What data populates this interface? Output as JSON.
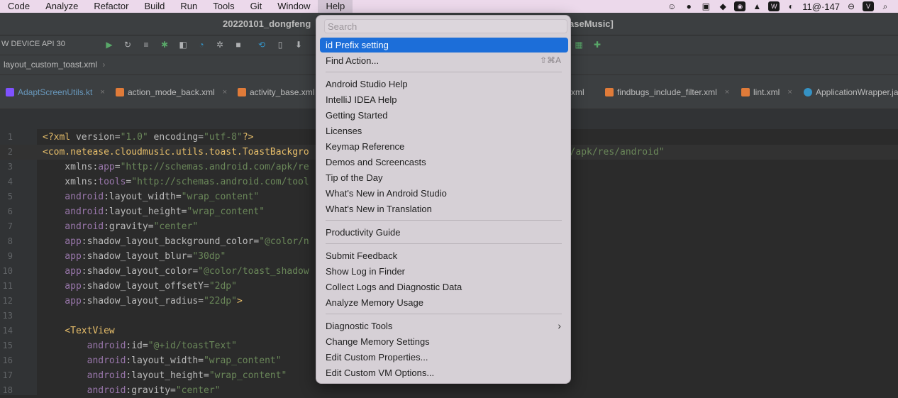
{
  "menubar": {
    "items": [
      "Code",
      "Analyze",
      "Refactor",
      "Build",
      "Run",
      "Tools",
      "Git",
      "Window",
      "Help"
    ],
    "status_text": "11@·147"
  },
  "titlebar": {
    "project": "20220101_dongfeng",
    "module_suffix": "aseMusic]"
  },
  "toolbar": {
    "device": "W DEVICE API 30"
  },
  "breadcrumb": {
    "file": "layout_custom_toast.xml",
    "chevron": "›"
  },
  "tabs": [
    {
      "label": "AdaptScreenUtils.kt",
      "icon_color": "#7f52ff"
    },
    {
      "label": "action_mode_back.xml",
      "icon_color": "#e07b39"
    },
    {
      "label": "activity_base.xml",
      "icon_color": "#e07b39"
    },
    {
      "label": "xml",
      "icon_color": ""
    },
    {
      "label": "findbugs_include_filter.xml",
      "icon_color": "#e07b39"
    },
    {
      "label": "lint.xml",
      "icon_color": "#e07b39"
    },
    {
      "label": "ApplicationWrapper.ja",
      "icon_color": "#3592c4"
    }
  ],
  "editor": {
    "line_numbers": [
      "1",
      "2",
      "3",
      "4",
      "5",
      "6",
      "7",
      "8",
      "9",
      "10",
      "11",
      "12",
      "13",
      "14",
      "15",
      "16",
      "17",
      "18"
    ],
    "lines": [
      [
        [
          "t-pun",
          "<?xml "
        ],
        [
          "t-attr",
          "version="
        ],
        [
          "t-val",
          "\"1.0\""
        ],
        [
          "t-attr",
          " encoding="
        ],
        [
          "t-val",
          "\"utf-8\""
        ],
        [
          "t-pun",
          "?>"
        ]
      ],
      [
        [
          "t-tag",
          "<com.netease.cloudmusic.utils.toast.ToastBackgro"
        ],
        [
          "t-attr",
          "                                         "
        ],
        [
          "t-val",
          "id.com/apk/res/android\""
        ]
      ],
      [
        [
          "t-attr",
          "    xmlns:"
        ],
        [
          "t-ns",
          "app"
        ],
        [
          "t-attr",
          "="
        ],
        [
          "t-val",
          "\"http://schemas.android.com/apk/re"
        ]
      ],
      [
        [
          "t-attr",
          "    xmlns:"
        ],
        [
          "t-ns",
          "tools"
        ],
        [
          "t-attr",
          "="
        ],
        [
          "t-val",
          "\"http://schemas.android.com/tool"
        ]
      ],
      [
        [
          "t-ns",
          "    android"
        ],
        [
          "t-attr",
          ":layout_width="
        ],
        [
          "t-val",
          "\"wrap_content\""
        ]
      ],
      [
        [
          "t-ns",
          "    android"
        ],
        [
          "t-attr",
          ":layout_height="
        ],
        [
          "t-val",
          "\"wrap_content\""
        ]
      ],
      [
        [
          "t-ns",
          "    android"
        ],
        [
          "t-attr",
          ":gravity="
        ],
        [
          "t-val",
          "\"center\""
        ]
      ],
      [
        [
          "t-ns",
          "    app"
        ],
        [
          "t-attr",
          ":shadow_layout_background_color="
        ],
        [
          "t-val",
          "\"@color/n"
        ]
      ],
      [
        [
          "t-ns",
          "    app"
        ],
        [
          "t-attr",
          ":shadow_layout_blur="
        ],
        [
          "t-val",
          "\"30dp\""
        ]
      ],
      [
        [
          "t-ns",
          "    app"
        ],
        [
          "t-attr",
          ":shadow_layout_color="
        ],
        [
          "t-val",
          "\"@color/toast_shadow"
        ]
      ],
      [
        [
          "t-ns",
          "    app"
        ],
        [
          "t-attr",
          ":shadow_layout_offsetY="
        ],
        [
          "t-val",
          "\"2dp\""
        ]
      ],
      [
        [
          "t-ns",
          "    app"
        ],
        [
          "t-attr",
          ":shadow_layout_radius="
        ],
        [
          "t-val",
          "\"22dp\""
        ],
        [
          "t-pun",
          ">"
        ]
      ],
      [
        [
          "t-attr",
          ""
        ]
      ],
      [
        [
          "t-tag",
          "    <TextView"
        ]
      ],
      [
        [
          "t-ns",
          "        android"
        ],
        [
          "t-attr",
          ":id="
        ],
        [
          "t-val",
          "\"@+id/toastText\""
        ]
      ],
      [
        [
          "t-ns",
          "        android"
        ],
        [
          "t-attr",
          ":layout_width="
        ],
        [
          "t-val",
          "\"wrap_content\""
        ]
      ],
      [
        [
          "t-ns",
          "        android"
        ],
        [
          "t-attr",
          ":layout_height="
        ],
        [
          "t-val",
          "\"wrap_content\""
        ]
      ],
      [
        [
          "t-ns",
          "        android"
        ],
        [
          "t-attr",
          ":gravity="
        ],
        [
          "t-val",
          "\"center\""
        ]
      ]
    ]
  },
  "help_menu": {
    "search_placeholder": "Search",
    "items": {
      "id_prefix": "id Prefix setting",
      "find_action": "Find Action...",
      "find_action_shortcut": "⇧⌘A",
      "android_studio_help": "Android Studio Help",
      "intellij_help": "IntelliJ IDEA Help",
      "getting_started": "Getting Started",
      "licenses": "Licenses",
      "keymap_reference": "Keymap Reference",
      "demos": "Demos and Screencasts",
      "tip_of_day": "Tip of the Day",
      "whats_new_as": "What's New in Android Studio",
      "whats_new_translation": "What's New in Translation",
      "productivity_guide": "Productivity Guide",
      "submit_feedback": "Submit Feedback",
      "show_log": "Show Log in Finder",
      "collect_logs": "Collect Logs and Diagnostic Data",
      "analyze_memory": "Analyze Memory Usage",
      "diagnostic_tools": "Diagnostic Tools",
      "change_memory": "Change Memory Settings",
      "edit_custom_props": "Edit Custom Properties...",
      "edit_custom_vm": "Edit Custom VM Options..."
    }
  }
}
